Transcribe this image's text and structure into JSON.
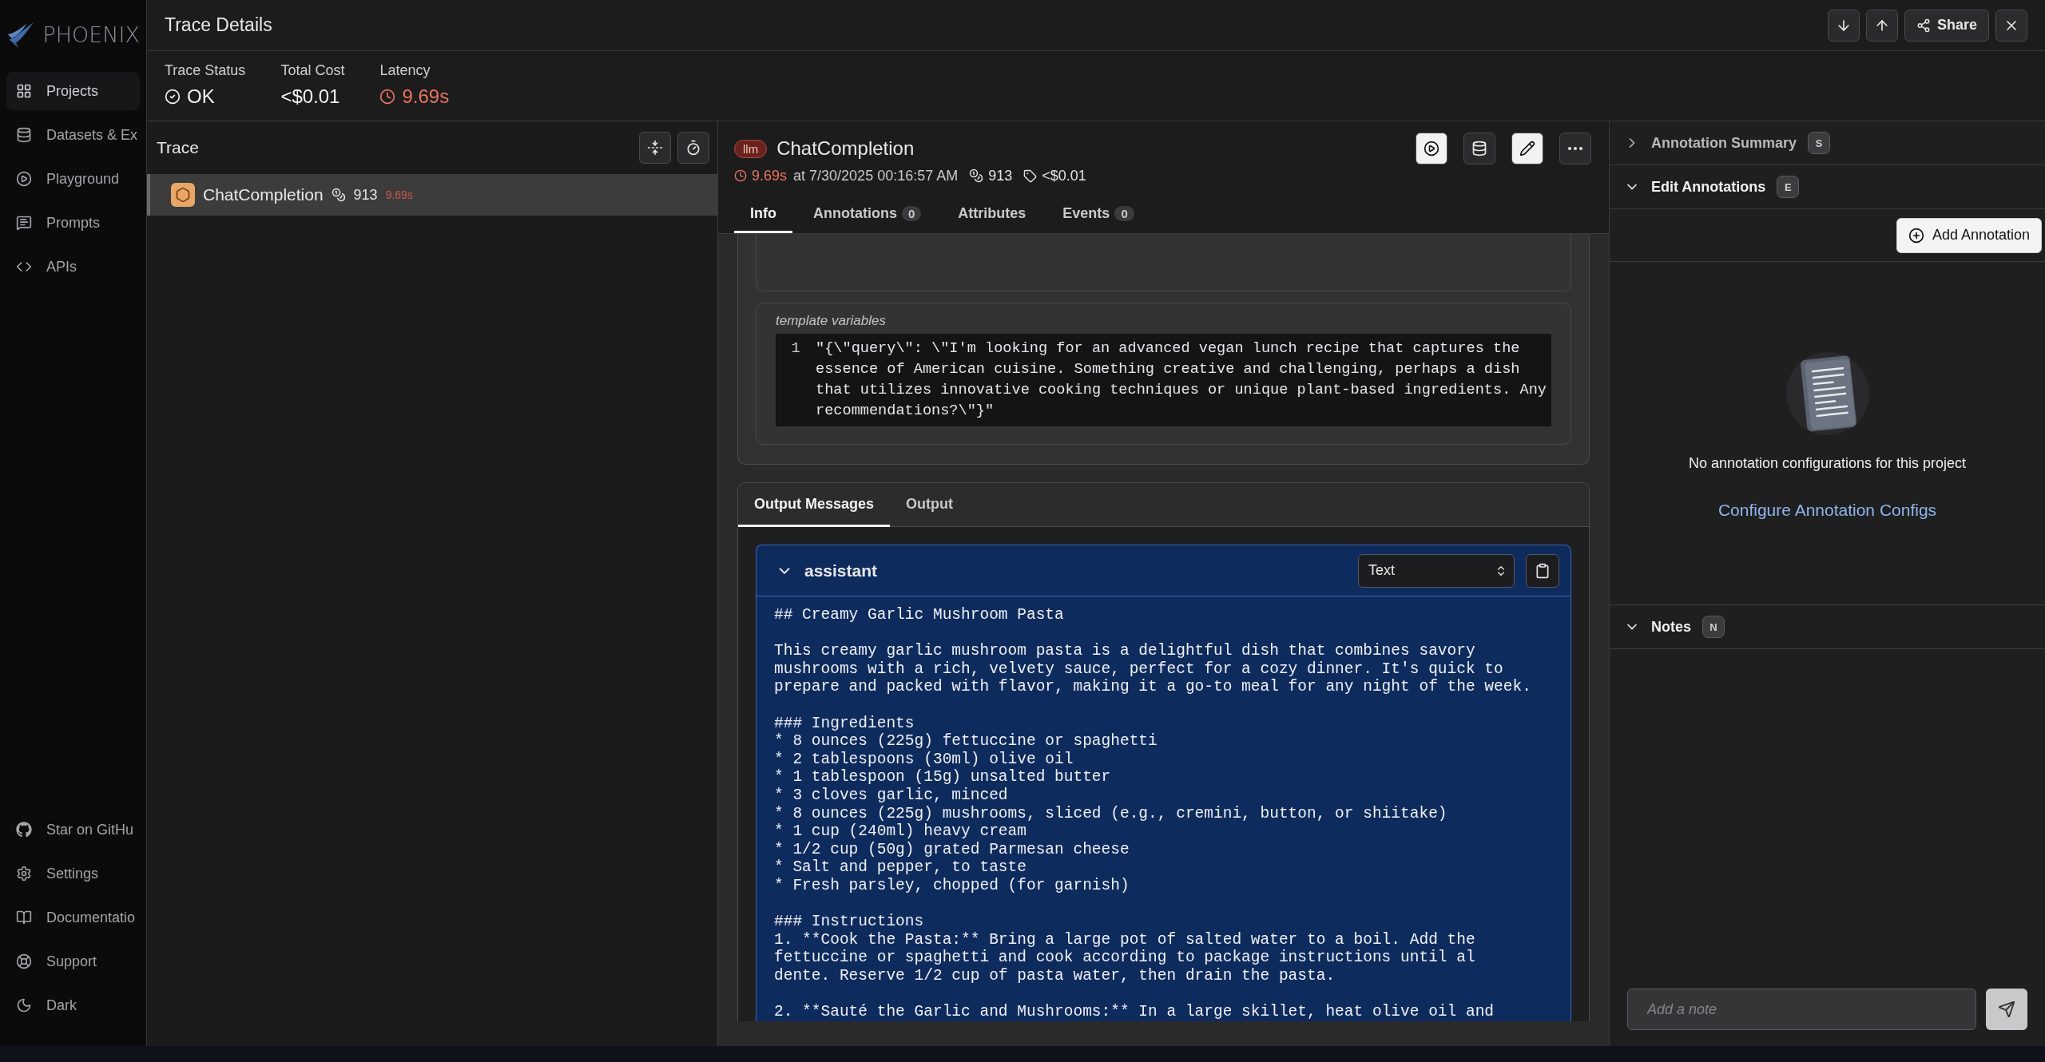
{
  "sidebar": {
    "logo": "PHOENIX",
    "items": [
      {
        "label": "Projects",
        "selected": true
      },
      {
        "label": "Datasets & Ex",
        "selected": false
      },
      {
        "label": "Playground",
        "selected": false
      },
      {
        "label": "Prompts",
        "selected": false
      },
      {
        "label": "APIs",
        "selected": false
      }
    ],
    "footer_items": [
      {
        "label": "Star on GitHu"
      },
      {
        "label": "Settings"
      },
      {
        "label": "Documentatio"
      },
      {
        "label": "Support"
      },
      {
        "label": "Dark"
      }
    ]
  },
  "drawer": {
    "title": "Trace Details",
    "share_button": "Share",
    "stats": [
      {
        "label": "Trace Status",
        "value": "OK",
        "kind": "status"
      },
      {
        "label": "Total Cost",
        "value": "<$0.01",
        "kind": "plain"
      },
      {
        "label": "Latency",
        "value": "9.69s",
        "kind": "latency"
      }
    ]
  },
  "trace": {
    "title": "Trace",
    "spans": [
      {
        "name": "ChatCompletion",
        "tokens": "913",
        "latency": "9.69s",
        "selected": true
      }
    ]
  },
  "span": {
    "kind_badge": "llm",
    "name": "ChatCompletion",
    "latency": "9.69s",
    "timestamp": "at 7/30/2025 00:16:57 AM",
    "tokens": "913",
    "cost": "<$0.01",
    "actions": [
      {
        "kind": "light"
      },
      {
        "kind": "dark"
      },
      {
        "kind": "light"
      },
      {
        "kind": "dark"
      }
    ],
    "tabs": [
      {
        "label": "Info",
        "selected": true
      },
      {
        "label": "Annotations",
        "count": "0",
        "selected": false
      },
      {
        "label": "Attributes",
        "selected": false
      },
      {
        "label": "Events",
        "count": "0",
        "selected": false
      }
    ],
    "template_variables": {
      "label": "template variables",
      "lines": [
        {
          "number": "1",
          "text": "\"{\\\"query\\\": \\\"I'm looking for an advanced vegan lunch recipe that captures the essence of American cuisine. Something creative and challenging, perhaps a dish that utilizes innovative cooking techniques or unique plant-based ingredients. Any recommendations?\\\"}\""
        }
      ]
    },
    "output": {
      "tabs": [
        {
          "label": "Output Messages",
          "selected": true
        },
        {
          "label": "Output",
          "selected": false
        }
      ],
      "messages": [
        {
          "role": "assistant",
          "expanded": true,
          "format": "Text",
          "content": "## Creamy Garlic Mushroom Pasta\n\nThis creamy garlic mushroom pasta is a delightful dish that combines savory mushrooms with a rich, velvety sauce, perfect for a cozy dinner. It's quick to prepare and packed with flavor, making it a go-to meal for any night of the week.\n\n### Ingredients\n* 8 ounces (225g) fettuccine or spaghetti\n* 2 tablespoons (30ml) olive oil\n* 1 tablespoon (15g) unsalted butter\n* 3 cloves garlic, minced\n* 8 ounces (225g) mushrooms, sliced (e.g., cremini, button, or shiitake)\n* 1 cup (240ml) heavy cream\n* 1/2 cup (50g) grated Parmesan cheese\n* Salt and pepper, to taste\n* Fresh parsley, chopped (for garnish)\n\n### Instructions\n1. **Cook the Pasta:** Bring a large pot of salted water to a boil. Add the fettuccine or spaghetti and cook according to package instructions until al dente. Reserve 1/2 cup of pasta water, then drain the pasta.\n\n2. **Sauté the Garlic and Mushrooms:** In a large skillet, heat olive oil and"
        }
      ]
    }
  },
  "annotations": {
    "sections": [
      {
        "title": "Annotation Summary",
        "hotkey": "S",
        "expanded": false
      },
      {
        "title": "Edit Annotations",
        "hotkey": "E",
        "expanded": true
      }
    ],
    "add_button": "Add Annotation",
    "empty_message": "No annotation configurations for this project",
    "configure_link": "Configure Annotation Configs",
    "notes": {
      "title": "Notes",
      "hotkey": "N",
      "expanded": true,
      "placeholder": "Add a note"
    }
  }
}
